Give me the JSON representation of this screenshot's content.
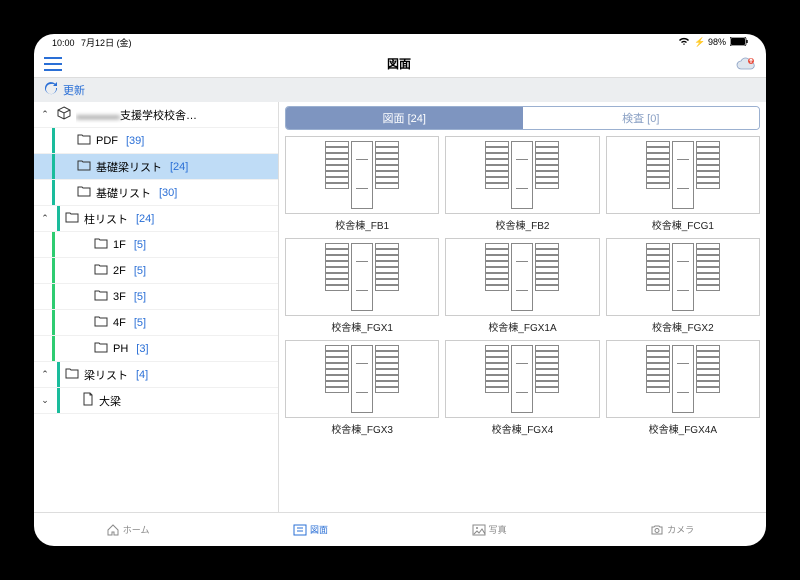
{
  "status": {
    "time": "10:00",
    "date": "7月12日 (金)",
    "battery": "98%"
  },
  "header": {
    "title": "図面"
  },
  "refresh": {
    "label": "更新"
  },
  "tree": {
    "root": {
      "label": "支援学校校舎…",
      "prefix": "▬▬▬▬"
    },
    "items": [
      {
        "label": "PDF",
        "count": "[39]",
        "indent": 1,
        "bar": "teal",
        "icon": "folder"
      },
      {
        "label": "基礎梁リスト",
        "count": "[24]",
        "indent": 1,
        "bar": "teal",
        "icon": "folder",
        "selected": true
      },
      {
        "label": "基礎リスト",
        "count": "[30]",
        "indent": 1,
        "bar": "teal",
        "icon": "folder"
      },
      {
        "label": "柱リスト",
        "count": "[24]",
        "indent": 0,
        "bar": "teal",
        "icon": "folder",
        "chev": "open"
      },
      {
        "label": "1F",
        "count": "[5]",
        "indent": 2,
        "bar": "green",
        "icon": "folder"
      },
      {
        "label": "2F",
        "count": "[5]",
        "indent": 2,
        "bar": "green",
        "icon": "folder"
      },
      {
        "label": "3F",
        "count": "[5]",
        "indent": 2,
        "bar": "green",
        "icon": "folder"
      },
      {
        "label": "4F",
        "count": "[5]",
        "indent": 2,
        "bar": "green",
        "icon": "folder"
      },
      {
        "label": "PH",
        "count": "[3]",
        "indent": 2,
        "bar": "green",
        "icon": "folder"
      },
      {
        "label": "梁リスト",
        "count": "[4]",
        "indent": 0,
        "bar": "teal",
        "icon": "folder",
        "chev": "open"
      },
      {
        "label": "大梁",
        "count": "",
        "indent": 1,
        "bar": "teal",
        "icon": "file",
        "chev": "closed"
      }
    ]
  },
  "tabs": {
    "active": "図面 [24]",
    "inactive": "検査 [0]"
  },
  "thumbs": [
    {
      "label": "校舎棟_FB1"
    },
    {
      "label": "校舎棟_FB2"
    },
    {
      "label": "校舎棟_FCG1"
    },
    {
      "label": "校舎棟_FGX1"
    },
    {
      "label": "校舎棟_FGX1A"
    },
    {
      "label": "校舎棟_FGX2"
    },
    {
      "label": "校舎棟_FGX3"
    },
    {
      "label": "校舎棟_FGX4"
    },
    {
      "label": "校舎棟_FGX4A"
    }
  ],
  "bottom": {
    "home": "ホーム",
    "drawing": "図面",
    "photo": "写真",
    "camera": "カメラ"
  }
}
